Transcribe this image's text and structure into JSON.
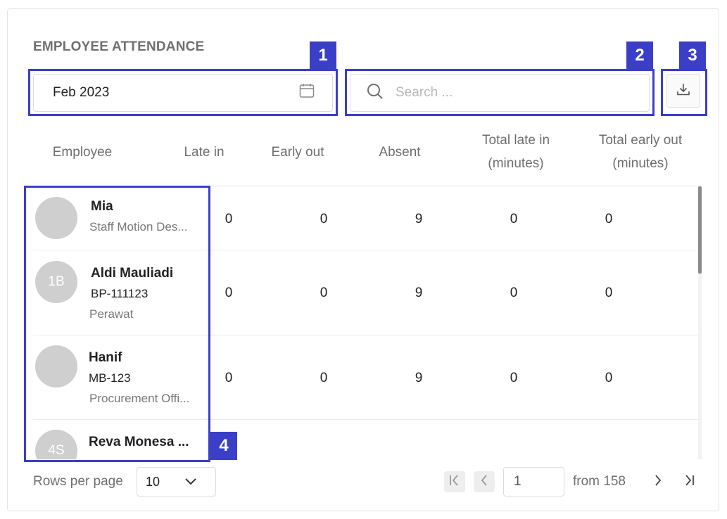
{
  "title": "EMPLOYEE ATTENDANCE",
  "month_picker": {
    "value": "Feb 2023",
    "icon": "calendar-icon"
  },
  "search": {
    "placeholder": "Search ...",
    "icon": "search-icon"
  },
  "download": {
    "icon": "download-icon"
  },
  "columns": [
    "Employee",
    "Late in",
    "Early out",
    "Absent",
    "Total late in (minutes)",
    "Total early out (minutes)"
  ],
  "rows": [
    {
      "avatar_initials": "",
      "name": "Mia",
      "code": "",
      "position": "Staff Motion Des...",
      "late_in": "0",
      "early_out": "0",
      "absent": "9",
      "total_late_in": "0",
      "total_early_out": "0"
    },
    {
      "avatar_initials": "1B",
      "name": "Aldi Mauliadi",
      "code": "BP-111123",
      "position": "Perawat",
      "late_in": "0",
      "early_out": "0",
      "absent": "9",
      "total_late_in": "0",
      "total_early_out": "0"
    },
    {
      "avatar_initials": "",
      "name": "Hanif",
      "code": "MB-123",
      "position": "Procurement Offi...",
      "late_in": "0",
      "early_out": "0",
      "absent": "9",
      "total_late_in": "0",
      "total_early_out": "0"
    },
    {
      "avatar_initials": "4S",
      "name": "Reva Monesa ...",
      "code": "",
      "position": "",
      "late_in": "",
      "early_out": "",
      "absent": "",
      "total_late_in": "",
      "total_early_out": ""
    }
  ],
  "pagination": {
    "rows_per_page_label": "Rows per page",
    "rows_per_page_value": "10",
    "current_page": "1",
    "total_label": "from 158"
  },
  "annotations": [
    "1",
    "2",
    "3",
    "4"
  ],
  "colors": {
    "annotation": "#3b3fc7",
    "avatar": "#cfcfcf",
    "muted_text": "#6f6f6f"
  }
}
